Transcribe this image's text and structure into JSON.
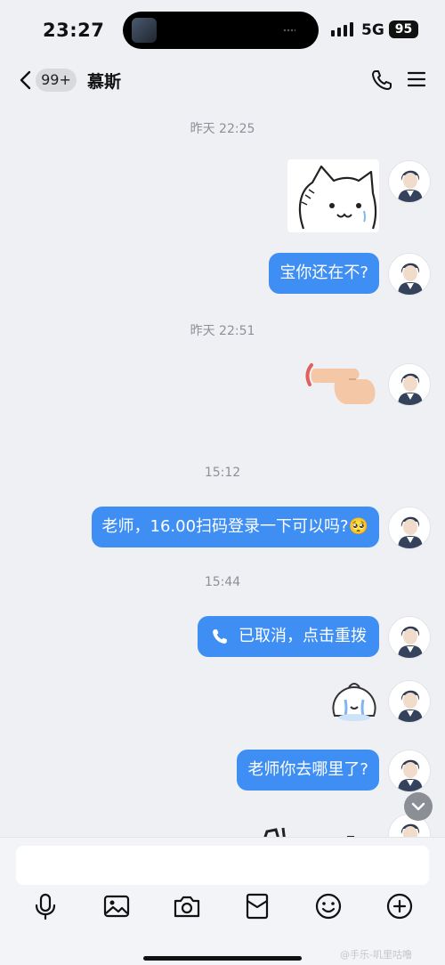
{
  "status_bar": {
    "time": "23:27",
    "network": "5G",
    "battery": "95"
  },
  "nav": {
    "unread_count": "99+",
    "contact_name": "慕斯"
  },
  "messages": {
    "ts1": "昨天 22:25",
    "msg_still_there": "宝你还在不?",
    "ts2": "昨天 22:51",
    "ts3": "15:12",
    "msg_login": "老师，16.00扫码登录一下可以吗?🥺",
    "ts4": "15:44",
    "call_status": "已取消，点击重拨",
    "msg_where": "老师你去哪里了?"
  },
  "input": {
    "value": "",
    "placeholder": ""
  },
  "toolbar": [
    "microphone-icon",
    "image-icon",
    "camera-icon",
    "red-packet-icon",
    "emoji-icon",
    "plus-icon"
  ],
  "watermark": "@手乐-叽里咕噜",
  "colors": {
    "bubble": "#3e8ef4",
    "background": "#eef0f4",
    "accent": "#3e8ef4"
  }
}
